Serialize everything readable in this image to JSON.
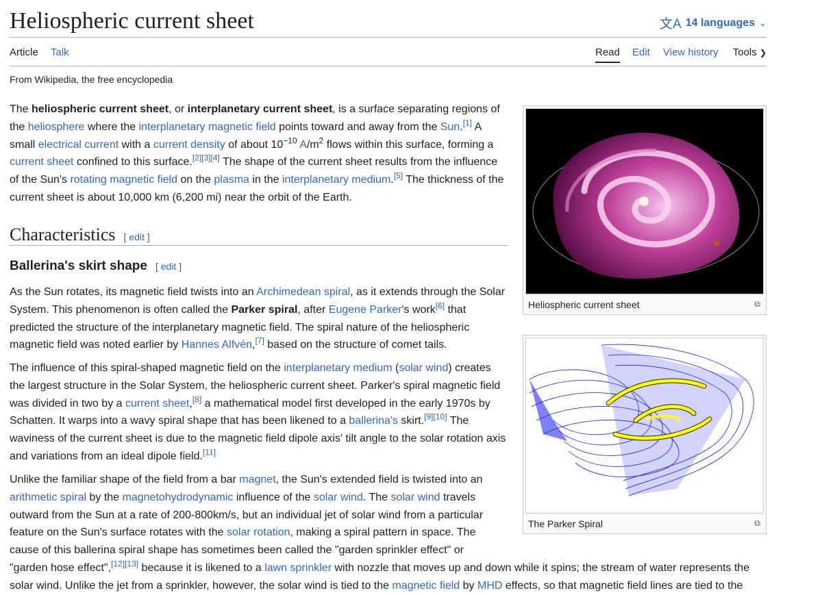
{
  "title": "Heliospheric current sheet",
  "languages": {
    "icon": "translate-icon",
    "label": "14 languages"
  },
  "tabs": {
    "article": "Article",
    "talk": "Talk",
    "read": "Read",
    "edit": "Edit",
    "history": "View history",
    "tools": "Tools"
  },
  "tagline": "From Wikipedia, the free encyclopedia",
  "sections": {
    "h2": "Characteristics",
    "h2_edit": "edit",
    "h3": "Ballerina's skirt shape",
    "h3_edit": "edit"
  },
  "figures": [
    {
      "caption": "Heliospheric current sheet"
    },
    {
      "caption": "The Parker Spiral"
    }
  ],
  "colors": {
    "link": "#3366cc",
    "text": "#202122",
    "border": "#a2a9b1"
  }
}
